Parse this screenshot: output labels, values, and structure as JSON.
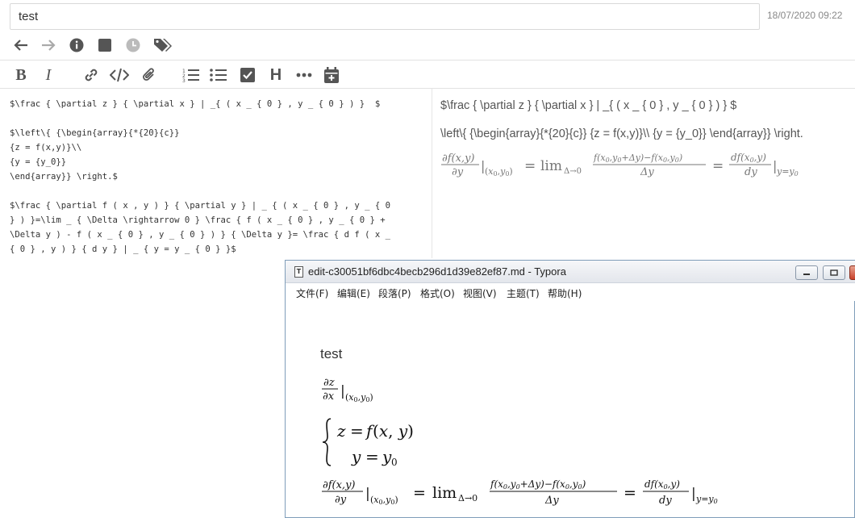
{
  "header": {
    "title_value": "test",
    "date": "18/07/2020 09:22"
  },
  "nav_icons": [
    "arrow-left-icon",
    "arrow-right-icon",
    "info-icon",
    "square-icon",
    "clock-icon",
    "tags-icon"
  ],
  "toolbar_icons": [
    "bold-icon",
    "italic-icon",
    "link-icon",
    "code-icon",
    "attachment-icon",
    "ordered-list-icon",
    "unordered-list-icon",
    "checkbox-icon",
    "heading-icon",
    "more-icon",
    "calendar-icon"
  ],
  "toolbar": {
    "bold": "B",
    "italic": "I",
    "heading": "H"
  },
  "editor": {
    "lines": [
      "$\\frac { \\partial z } { \\partial x } | _{ ( x _ { 0 } , y _ { 0 } ) }  $",
      "",
      "$\\left\\{ {\\begin{array}{*{20}{c}}",
      "{z = f(x,y)}\\\\",
      "{y = {y_0}}",
      "\\end{array}} \\right.$",
      "",
      "$\\frac { \\partial f ( x , y ) } { \\partial y } | _ { ( x _ { 0 } , y _ { 0",
      "} ) }=\\lim _ { \\Delta \\rightarrow 0 } \\frac { f ( x _ { 0 } , y _ { 0 } +",
      "\\Delta y ) - f ( x _ { 0 } , y _ { 0 } ) } { \\Delta y }= \\frac { d f ( x _",
      "{ 0 } , y ) } { d y } | _ { y = y _ { 0 } }$"
    ]
  },
  "preview": {
    "line1": "$\\frac { \\partial z } { \\partial x } | _{ ( x _ { 0 } , y _ { 0 } ) }  $",
    "line2": "\\left\\{ {\\begin{array}{*{20}{c}} {z = f(x,y)}\\\\ {y = {y_0}} \\end{array}} \\right."
  },
  "typora": {
    "window_title": "edit-c30051bf6dbc4becb296d1d39e82ef87.md - Typora",
    "file_icon_glyph": "T",
    "menu": [
      "文件(F)",
      "编辑(E)",
      "段落(P)",
      "格式(O)",
      "视图(V)",
      "主题(T)",
      "帮助(H)"
    ],
    "heading": "test"
  },
  "colors": {
    "icon": "#555555",
    "date": "#888888",
    "editor_keyword": "#3344aa",
    "window_border": "#7f9db9"
  }
}
